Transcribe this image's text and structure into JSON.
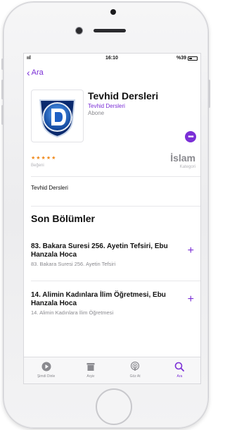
{
  "status_bar": {
    "signal": "ııl",
    "time": "16:10",
    "battery": "%39"
  },
  "nav": {
    "back_label": "Ara"
  },
  "podcast": {
    "title": "Tevhid Dersleri",
    "author": "Tevhid Dersleri",
    "subscription": "Abone",
    "more_icon": "ellipsis-icon",
    "rating_stars": "★★★★★",
    "rating_label": "Beğeni",
    "category": "İslam",
    "category_label": "Kategori",
    "description": "Tevhid Dersleri"
  },
  "episodes_section": {
    "title": "Son Bölümler"
  },
  "episodes": [
    {
      "title": "83. Bakara Suresi 256. Ayetin Tefsiri, Ebu Hanzala Hoca",
      "subtitle": "83. Bakara Suresi 256. Ayetin Tefsiri"
    },
    {
      "title": "14. Alimin Kadınlara İlim Öğretmesi, Ebu Hanzala Hoca",
      "subtitle": "14. Alimin Kadınlara İlim Öğretmesi"
    }
  ],
  "tabs": [
    {
      "label": "Şimdi Dinle",
      "icon": "play-circle-icon"
    },
    {
      "label": "Arşiv",
      "icon": "archive-icon"
    },
    {
      "label": "Göz At",
      "icon": "podcast-icon"
    },
    {
      "label": "Ara",
      "icon": "search-icon",
      "active": true
    }
  ],
  "colors": {
    "accent": "#7b2fd6",
    "stars": "#f08a1c"
  }
}
